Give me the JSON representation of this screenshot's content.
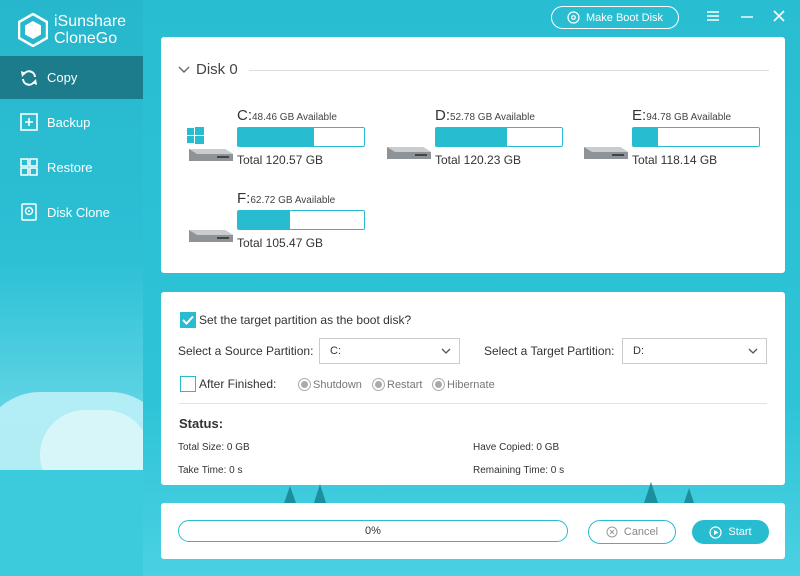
{
  "app": {
    "brand_line1": "iSunshare",
    "brand_line2": "CloneGo"
  },
  "sidebar": {
    "items": [
      {
        "label": "Copy",
        "icon": "sync-icon",
        "active": true
      },
      {
        "label": "Backup",
        "icon": "backup-icon",
        "active": false
      },
      {
        "label": "Restore",
        "icon": "restore-icon",
        "active": false
      },
      {
        "label": "Disk Clone",
        "icon": "disk-clone-icon",
        "active": false
      }
    ]
  },
  "header": {
    "make_boot_disk": "Make Boot Disk"
  },
  "disk": {
    "title": "Disk 0",
    "drives": [
      {
        "letter": "C:",
        "available": "48.46 GB Available",
        "total": "Total 120.57 GB",
        "used_fraction": 0.6,
        "system": true
      },
      {
        "letter": "D:",
        "available": "52.78 GB Available",
        "total": "Total 120.23 GB",
        "used_fraction": 0.56,
        "system": false
      },
      {
        "letter": "E:",
        "available": "94.78 GB Available",
        "total": "Total 118.14 GB",
        "used_fraction": 0.2,
        "system": false
      },
      {
        "letter": "F:",
        "available": "62.72 GB Available",
        "total": "Total 105.47 GB",
        "used_fraction": 0.41,
        "system": false
      }
    ]
  },
  "options": {
    "boot_checkbox_label": "Set the target partition as the boot disk?",
    "boot_checked": true,
    "source_label": "Select a Source Partition:",
    "source_value": "C:",
    "target_label": "Select a Target Partition:",
    "target_value": "D:",
    "after_finished_label": "After Finished:",
    "after_finished_checked": false,
    "radios": [
      "Shutdown",
      "Restart",
      "Hibernate"
    ]
  },
  "status": {
    "title": "Status:",
    "total_size": "Total Size: 0 GB",
    "have_copied": "Have Copied: 0 GB",
    "take_time": "Take Time: 0 s",
    "remaining_time": "Remaining Time: 0 s"
  },
  "footer": {
    "progress_text": "0%",
    "progress_value": 0,
    "cancel": "Cancel",
    "start": "Start"
  },
  "colors": {
    "accent": "#28bcd0",
    "sidebar_active": "#1c7c8b"
  }
}
